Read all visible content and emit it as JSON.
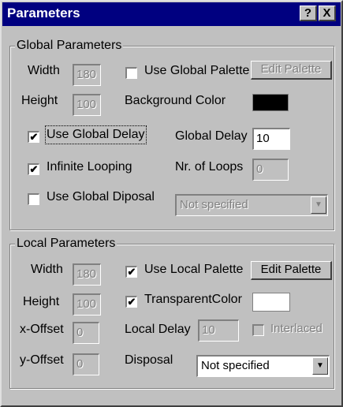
{
  "window": {
    "title": "Parameters",
    "help_button": "?",
    "close_button": "X"
  },
  "global": {
    "legend": "Global Parameters",
    "width_label": "Width",
    "width_value": "180",
    "height_label": "Height",
    "height_value": "100",
    "use_global_palette_label": "Use Global Palette",
    "use_global_palette_checked": false,
    "edit_palette_label": "Edit Palette",
    "background_color_label": "Background Color",
    "background_color": "#000000",
    "use_global_delay_label": "Use Global Delay",
    "use_global_delay_checked": true,
    "global_delay_label": "Global Delay",
    "global_delay_value": "10",
    "infinite_looping_label": "Infinite Looping",
    "infinite_looping_checked": true,
    "nr_of_loops_label": "Nr. of Loops",
    "nr_of_loops_value": "0",
    "use_global_disposal_label": "Use Global Diposal",
    "use_global_disposal_checked": false,
    "disposal_value": "Not specified"
  },
  "local": {
    "legend": "Local Parameters",
    "width_label": "Width",
    "width_value": "180",
    "height_label": "Height",
    "height_value": "100",
    "x_offset_label": "x-Offset",
    "x_offset_value": "0",
    "y_offset_label": "y-Offset",
    "y_offset_value": "0",
    "use_local_palette_label": "Use Local Palette",
    "use_local_palette_checked": true,
    "edit_palette_label": "Edit Palette",
    "transparent_color_label": "TransparentColor",
    "transparent_color_checked": true,
    "transparent_color": "#ffffff",
    "local_delay_label": "Local Delay",
    "local_delay_value": "10",
    "interlaced_label": "Interlaced",
    "interlaced_checked": false,
    "disposal_label": "Disposal",
    "disposal_value": "Not specified"
  },
  "icons": {
    "check": "✔",
    "dropdown": "▼"
  }
}
